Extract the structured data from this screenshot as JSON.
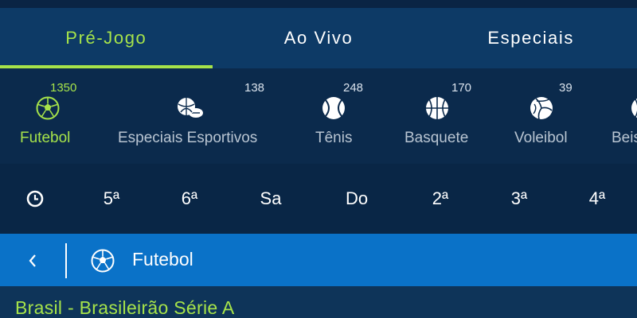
{
  "tabs": [
    {
      "label": "Pré-Jogo",
      "active": true
    },
    {
      "label": "Ao Vivo",
      "active": false
    },
    {
      "label": "Especiais",
      "active": false
    }
  ],
  "sports": [
    {
      "label": "Futebol",
      "count": "1350",
      "icon": "soccer-ball-icon",
      "active": true
    },
    {
      "label": "Especiais Esportivos",
      "count": "138",
      "icon": "sports-balls-icon",
      "active": false
    },
    {
      "label": "Tênis",
      "count": "248",
      "icon": "tennis-ball-icon",
      "active": false
    },
    {
      "label": "Basquete",
      "count": "170",
      "icon": "basketball-icon",
      "active": false
    },
    {
      "label": "Voleibol",
      "count": "39",
      "icon": "volleyball-icon",
      "active": false
    },
    {
      "label": "Beis",
      "count": "",
      "icon": "baseball-icon",
      "active": false
    }
  ],
  "days": [
    "5ª",
    "6ª",
    "Sa",
    "Do",
    "2ª",
    "3ª",
    "4ª"
  ],
  "section": {
    "title": "Futebol",
    "icon": "soccer-ball-icon"
  },
  "league": {
    "title": "Brasil - Brasileirão Série A"
  },
  "colors": {
    "accent": "#a6e34a",
    "section_bar": "#0a72c8",
    "tabs_bg": "#0d3a66",
    "page_bg": "#0a2a4a"
  }
}
